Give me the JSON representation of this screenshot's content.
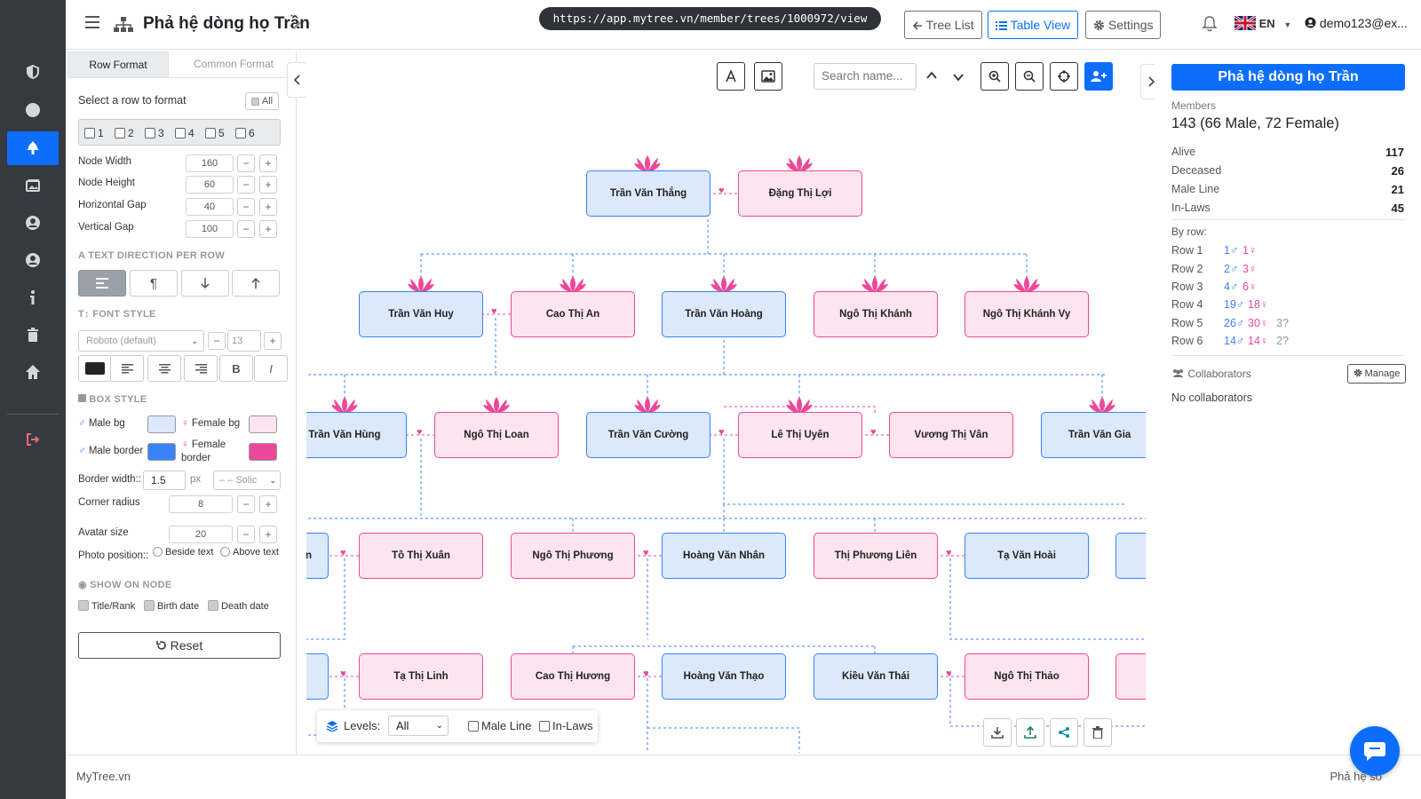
{
  "header": {
    "title": "Phả hệ dòng họ Trần",
    "url": "https://app.mytree.vn/member/trees/1000972/view",
    "tree_list_label": "Tree List",
    "table_view_label": "Table View",
    "settings_label": "Settings",
    "language": "EN",
    "user": "demo123@ex..."
  },
  "left_panel": {
    "tabs": [
      "Row Format",
      "Common Format"
    ],
    "select_row_label": "Select a row to format",
    "all_label": "All",
    "rows": [
      "1",
      "2",
      "3",
      "4",
      "5",
      "6"
    ],
    "node_width_label": "Node Width",
    "node_width": "160",
    "node_height_label": "Node Height",
    "node_height": "60",
    "hgap_label": "Horizontal Gap",
    "hgap": "40",
    "vgap_label": "Vertical Gap",
    "vgap": "100",
    "text_dir_label": "TEXT DIRECTION PER ROW",
    "font_style_label": "FONT STYLE",
    "font_family": "Roboto (default)",
    "font_size": "13",
    "bold_label": "B",
    "italic_label": "I",
    "box_style_label": "BOX STYLE",
    "male_bg_label": "Male bg",
    "female_bg_label": "Female bg",
    "male_border_label": "Male border",
    "female_border_label_1": "Female",
    "female_border_label_2": "border",
    "male_bg_color": "#dbe9fb",
    "female_bg_color": "#fde4ee",
    "male_border_color": "#3b82f6",
    "female_border_color": "#ec4899",
    "border_width_label": "Border width::",
    "border_width": "1.5",
    "px_label": "px",
    "border_style": "– – Solic",
    "corner_radius_label": "Corner radius",
    "corner_radius": "8",
    "avatar_size_label": "Avatar size",
    "avatar_size": "20",
    "photo_position_label": "Photo position::",
    "beside_text_label": "Beside text",
    "above_text_label": "Above text",
    "show_on_node_label": "SHOW ON NODE",
    "title_rank_label": "Title/Rank",
    "birth_date_label": "Birth date",
    "death_date_label": "Death date",
    "reset_label": "Reset",
    "minus": "−",
    "plus": "+"
  },
  "canvas": {
    "search_placeholder": "Search name...",
    "levels_label": "Levels:",
    "levels_value": "All",
    "male_line_label": "Male Line",
    "in_laws_label": "In-Laws",
    "nodes": {
      "r1": [
        "Trần Văn Thắng",
        "Đặng Thị Lợi"
      ],
      "r2": [
        "Trần Văn Huy",
        "Cao Thị An",
        "Trần Văn Hoàng",
        "Ngô Thị Khánh",
        "Ngô Thị Khánh Vy"
      ],
      "r3": [
        "Trần Văn Hùng",
        "Ngô Thị Loan",
        "Trần Văn Cường",
        "Lê Thị Uyên",
        "Vương Thị Vân",
        "Trần Văn Gia"
      ],
      "r4": [
        "uấn",
        "Tô Thị Xuân",
        "Ngô Thị Phương",
        "Hoàng Văn Nhân",
        "Thị Phương Liên",
        "Tạ Văn Hoài"
      ],
      "r5": [
        "Tạ Thị Linh",
        "Cao Thị Hương",
        "Hoàng Văn Thạo",
        "Kiều Văn Thái",
        "Ngô Thị Thảo"
      ]
    }
  },
  "right_panel": {
    "title": "Phả hệ dòng họ Trần",
    "members_label": "Members",
    "members_summary": "143 (66 Male, 72 Female)",
    "stats": [
      {
        "label": "Alive",
        "value": "117"
      },
      {
        "label": "Deceased",
        "value": "26"
      },
      {
        "label": "Male Line",
        "value": "21"
      },
      {
        "label": "In-Laws",
        "value": "45"
      }
    ],
    "by_row_label": "By row:",
    "by_row": [
      {
        "label": "Row 1",
        "male": "1♂",
        "female": "1♀",
        "unknown": ""
      },
      {
        "label": "Row 2",
        "male": "2♂",
        "female": "3♀",
        "unknown": ""
      },
      {
        "label": "Row 3",
        "male": "4♂",
        "female": "6♀",
        "unknown": ""
      },
      {
        "label": "Row 4",
        "male": "19♂",
        "female": "18♀",
        "unknown": ""
      },
      {
        "label": "Row 5",
        "male": "26♂",
        "female": "30♀",
        "unknown": "3?"
      },
      {
        "label": "Row 6",
        "male": "14♂",
        "female": "14♀",
        "unknown": "2?"
      }
    ],
    "collaborators_label": "Collaborators",
    "manage_label": "Manage",
    "no_collaborators": "No collaborators"
  },
  "footer": {
    "brand": "MyTree.vn",
    "right_text": "Phả hệ số"
  }
}
